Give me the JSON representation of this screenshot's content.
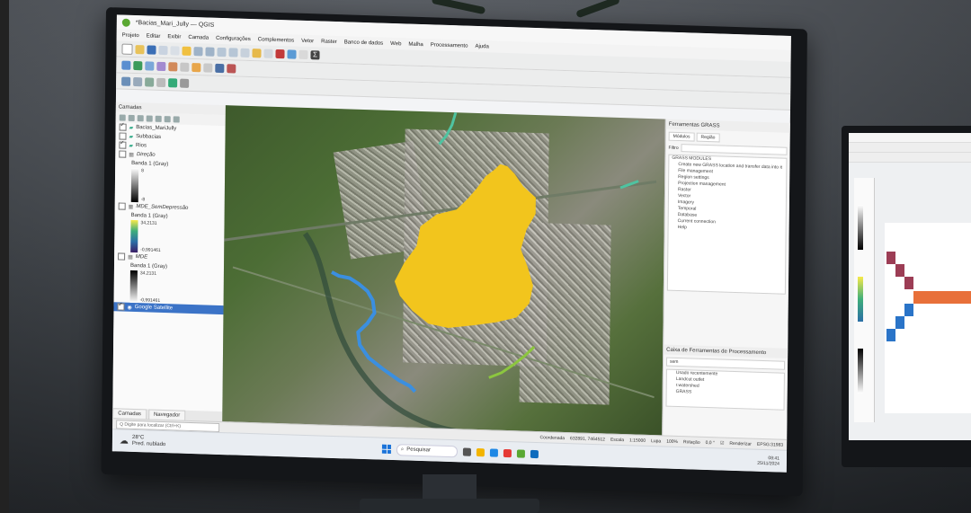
{
  "window": {
    "title": "*Bacias_Mari_Jully — QGIS"
  },
  "menu": [
    "Projeto",
    "Editar",
    "Exibir",
    "Camada",
    "Configurações",
    "Complementos",
    "Vetor",
    "Raster",
    "Banco de dados",
    "Web",
    "Malha",
    "Processamento",
    "Ajuda"
  ],
  "layers_panel": {
    "title": "Camadas",
    "items": [
      {
        "name": "Bacias_MariJully",
        "checked": true
      },
      {
        "name": "Subbacias",
        "checked": false
      },
      {
        "name": "Rios",
        "checked": true
      },
      {
        "name": "Direção",
        "checked": false
      },
      {
        "name": "Banda 1 (Gray)"
      },
      {
        "name": "MDE_SemDepressão",
        "checked": false
      },
      {
        "name": "Banda 1 (Gray)"
      },
      {
        "name": "MDE",
        "checked": false
      },
      {
        "name": "Banda 1 (Gray)"
      },
      {
        "name": "Google Satellite",
        "checked": true,
        "selected": true
      }
    ],
    "ramp_values": {
      "direcao_max": "8",
      "direcao_min": "-8",
      "mde_sd_max": "34,2131",
      "mde_sd_min": "-0,991461",
      "mde_max": "34,2131",
      "mde_min": "-0,991461"
    },
    "tabs": [
      "Camadas",
      "Navegador"
    ]
  },
  "right_panel": {
    "title": "Ferramentas GRASS",
    "tabs": [
      "Módulos",
      "Região"
    ],
    "filter_label": "Filtro",
    "tree_root": "GRASS MODULES",
    "tree_items": [
      "Create new GRASS location and transfer data into it",
      "File management",
      "Region settings",
      "Projection management",
      "Raster",
      "Vector",
      "Imagery",
      "Temporal",
      "Database",
      "Current connection",
      "Help"
    ],
    "processing_title": "Caixa de Ferramentas de Processamento",
    "search_placeholder": "sem",
    "processing_items": [
      "Usado recentemente",
      "Landcut outlet",
      "r.watershed",
      "GRASS"
    ]
  },
  "statusbar": {
    "locator_placeholder": "Q Digite para localizar (Ctrl+K)",
    "coordinate_label": "Coordenada",
    "coordinate": "632891, 7464512",
    "scale_label": "Escala",
    "scale": "1:15000",
    "magnifier_label": "Lupa",
    "magnifier": "100%",
    "rotation_label": "Rotação",
    "rotation": "0,0 °",
    "render_label": "Renderizar",
    "crs": "EPSG:31983"
  },
  "taskbar": {
    "temperature": "28°C",
    "weather": "Pred. nublado",
    "search": "Pesquisar",
    "time": "08:41",
    "date": "25/11/2024"
  },
  "colors": {
    "basin": "#f2c51d",
    "rivers": "#3b8fe0",
    "stream_green": "#8cc63f",
    "stream_teal": "#4fc3a1",
    "selection": "#3b73c7"
  }
}
